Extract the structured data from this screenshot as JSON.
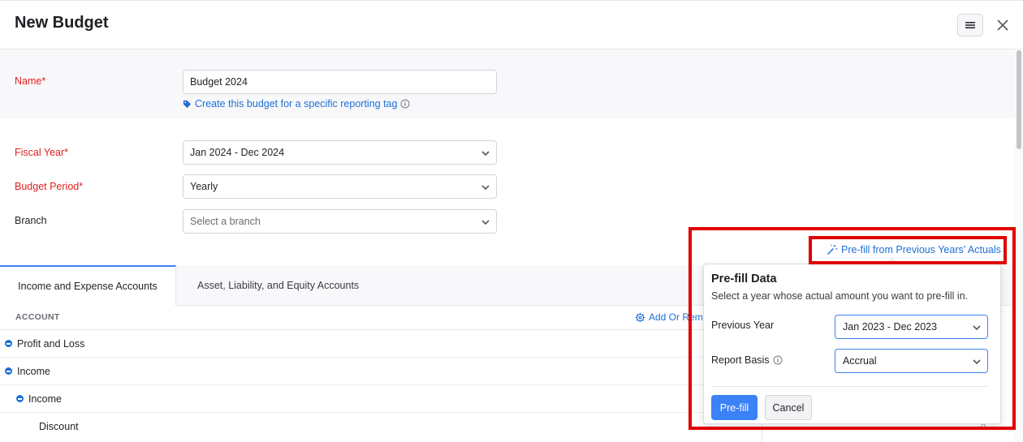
{
  "header": {
    "title": "New Budget",
    "menu_icon": "hamburger-icon",
    "close_icon": "close-icon"
  },
  "form": {
    "name": {
      "label": "Name*",
      "value": "Budget 2024"
    },
    "tag_link": "Create this budget for a specific reporting tag",
    "fiscal_year": {
      "label": "Fiscal Year*",
      "value": "Jan 2024 - Dec 2024"
    },
    "budget_period": {
      "label": "Budget Period*",
      "value": "Yearly"
    },
    "branch": {
      "label": "Branch",
      "placeholder": "Select a branch"
    }
  },
  "tabs": [
    {
      "label": "Income and Expense Accounts",
      "active": true
    },
    {
      "label": "Asset, Liability, and Equity Accounts",
      "active": false
    }
  ],
  "table": {
    "header_account": "ACCOUNT",
    "add_remove_label": "Add Or Remo",
    "rows": [
      {
        "label": "Profit and Loss",
        "level": 0,
        "collapsible": true
      },
      {
        "label": "Income",
        "level": 0,
        "collapsible": true
      },
      {
        "label": "Income",
        "level": 1,
        "collapsible": true
      },
      {
        "label": "Discount",
        "level": 2,
        "collapsible": false
      }
    ],
    "trailing_value": "0"
  },
  "prefill": {
    "link_label": "Pre-fill from Previous Years' Actuals",
    "title": "Pre-fill Data",
    "description": "Select a year whose actual amount you want to pre-fill in.",
    "previous_year": {
      "label": "Previous Year",
      "value": "Jan 2023 - Dec 2023"
    },
    "report_basis": {
      "label": "Report Basis",
      "value": "Accrual"
    },
    "submit_label": "Pre-fill",
    "cancel_label": "Cancel"
  },
  "colors": {
    "accent": "#3b82f6",
    "link": "#1f6fd6",
    "required": "#e02020",
    "highlight": "#e00000"
  }
}
